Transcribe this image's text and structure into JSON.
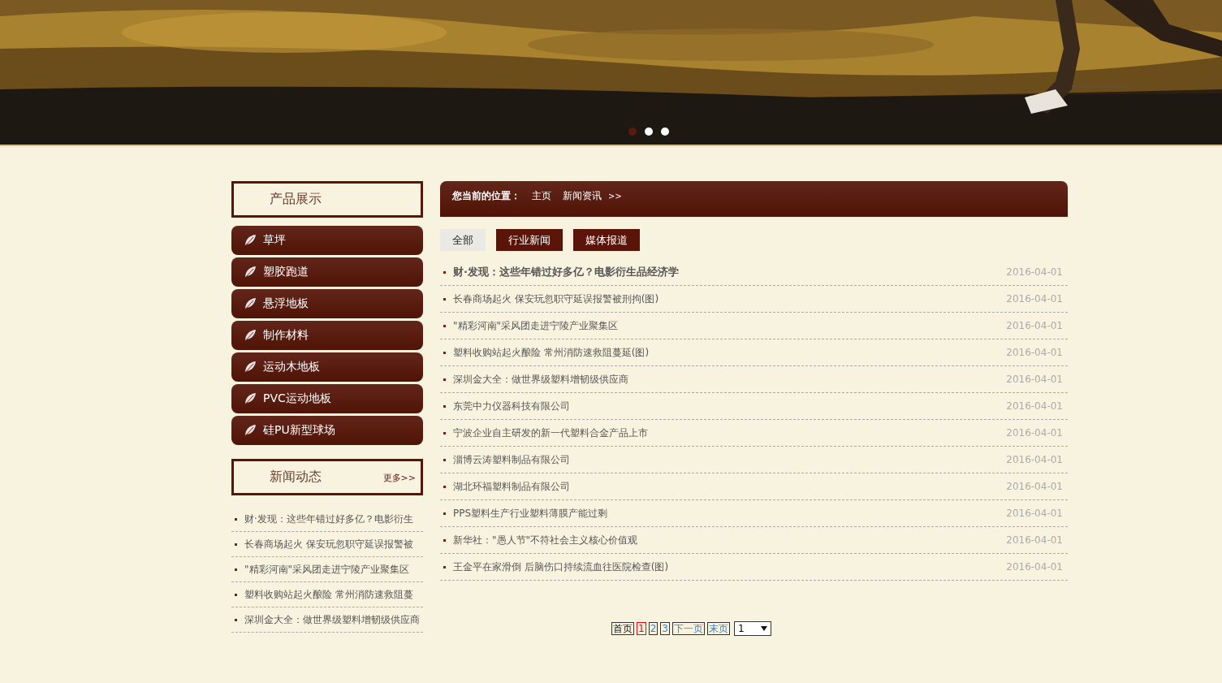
{
  "banner": {
    "dots": [
      {
        "selected": true
      },
      {
        "selected": false
      },
      {
        "selected": false
      }
    ]
  },
  "products": {
    "title": "产品展示",
    "items": [
      "草坪",
      "塑胶跑道",
      "悬浮地板",
      "制作材料",
      "运动木地板",
      "PVC运动地板",
      "硅PU新型球场"
    ]
  },
  "news_box": {
    "title": "新闻动态",
    "more": "更多>>",
    "items": [
      "财·发现：这些年错过好多亿？电影衍生",
      "长春商场起火 保安玩忽职守延误报警被",
      "\"精彩河南\"采风团走进宁陵产业聚集区",
      "塑料收购站起火酿险 常州消防速救阻蔓",
      "深圳金大全：做世界级塑料增韧级供应商"
    ]
  },
  "breadcrumb": {
    "label": "您当前的位置：",
    "items": [
      "主页",
      "新闻资讯"
    ],
    "separator": ">>"
  },
  "tabs": [
    {
      "label": "全部",
      "selected": true
    },
    {
      "label": "行业新闻",
      "selected": false
    },
    {
      "label": "媒体报道",
      "selected": false
    }
  ],
  "articles": [
    {
      "title": "财·发现：这些年错过好多亿？电影衍生品经济学",
      "date": "2016-04-01",
      "featured": true
    },
    {
      "title": "长春商场起火 保安玩忽职守延误报警被刑拘(图)",
      "date": "2016-04-01",
      "featured": false
    },
    {
      "title": "\"精彩河南\"采风团走进宁陵产业聚集区",
      "date": "2016-04-01",
      "featured": false
    },
    {
      "title": "塑料收购站起火酿险 常州消防速救阻蔓延(图)",
      "date": "2016-04-01",
      "featured": false
    },
    {
      "title": "深圳金大全：做世界级塑料增韧级供应商",
      "date": "2016-04-01",
      "featured": false
    },
    {
      "title": "东莞中力仪器科技有限公司",
      "date": "2016-04-01",
      "featured": false
    },
    {
      "title": "宁波企业自主研发的新一代塑料合金产品上市",
      "date": "2016-04-01",
      "featured": false
    },
    {
      "title": "淄博云涛塑料制品有限公司",
      "date": "2016-04-01",
      "featured": false
    },
    {
      "title": "湖北环福塑料制品有限公司",
      "date": "2016-04-01",
      "featured": false
    },
    {
      "title": "PPS塑料生产行业塑料薄膜产能过剩",
      "date": "2016-04-01",
      "featured": false
    },
    {
      "title": "新华社：\"愚人节\"不符社会主义核心价值观",
      "date": "2016-04-01",
      "featured": false
    },
    {
      "title": "王金平在家滑倒 后脑伤口持续流血往医院检查(图)",
      "date": "2016-04-01",
      "featured": false
    }
  ],
  "pagination": {
    "links": [
      {
        "label": "首页",
        "kind": "plain",
        "selected": false
      },
      {
        "label": "1",
        "kind": "page",
        "selected": true
      },
      {
        "label": "2",
        "kind": "page",
        "selected": false
      },
      {
        "label": "3",
        "kind": "page",
        "selected": false
      },
      {
        "label": "下一页",
        "kind": "link",
        "selected": false
      },
      {
        "label": "末页",
        "kind": "link",
        "selected": false
      }
    ],
    "select": "1"
  }
}
